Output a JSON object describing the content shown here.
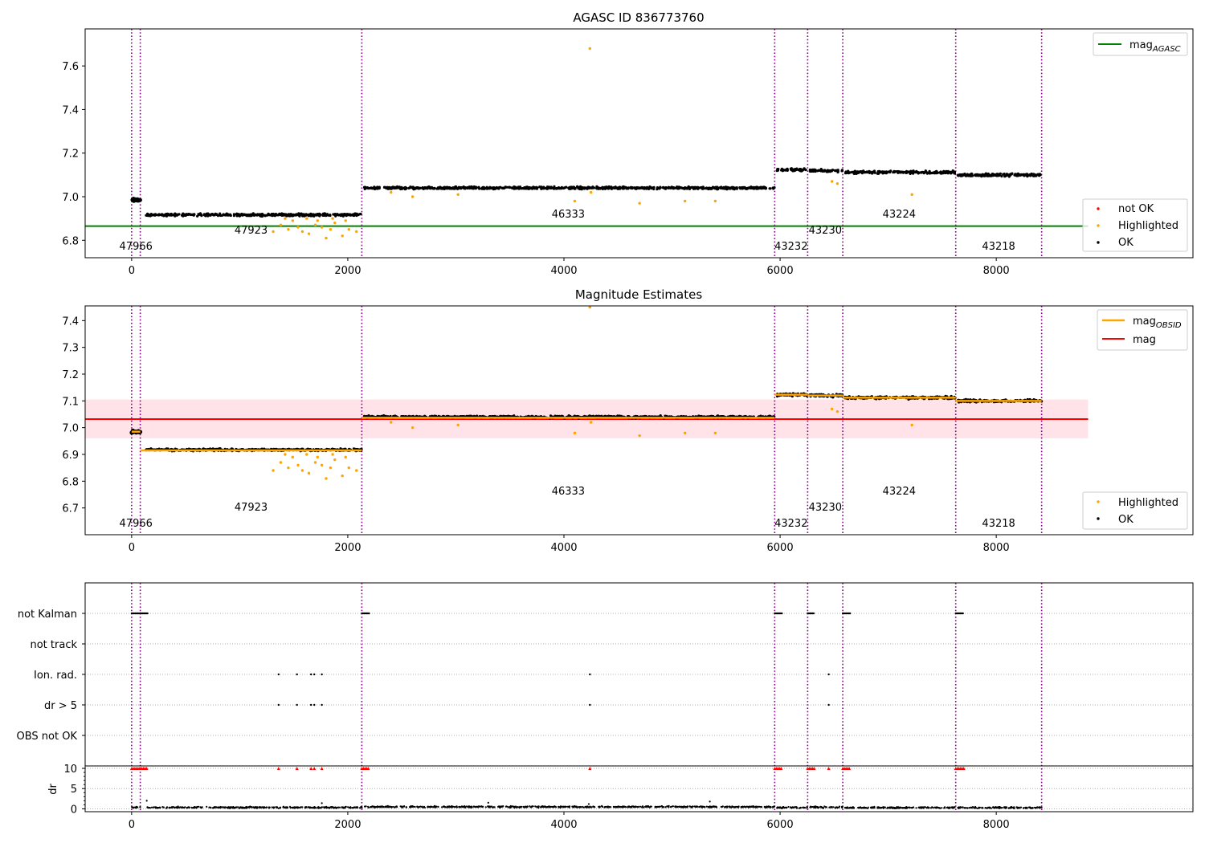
{
  "colors": {
    "ok": "#000000",
    "highlighted": "#ffa500",
    "not_ok": "#ff0000",
    "mag_agasc_line": "#008000",
    "mag_obsid_line": "#ffa500",
    "mag_line": "#ff0000",
    "mag_band": "#ffc0cb",
    "obsid_boundary": "#800080",
    "flag_grid": "#b0b0b0"
  },
  "chart_data": [
    {
      "type": "scatter",
      "title": "AGASC ID 836773760",
      "xlim": [
        -430,
        9820
      ],
      "ylim": [
        6.72,
        7.77
      ],
      "xticks": [
        0,
        2000,
        4000,
        6000,
        8000
      ],
      "xtick_labels": [
        "0",
        "2000",
        "4000",
        "6000",
        "8000"
      ],
      "yticks": [
        6.8,
        7.0,
        7.2,
        7.4,
        7.6
      ],
      "ytick_labels": [
        "6.8",
        "7.0",
        "7.2",
        "7.4",
        "7.6"
      ],
      "grid": false,
      "obsid_boundaries": [
        0,
        80,
        2130,
        5950,
        6255,
        6580,
        7625,
        8420
      ],
      "obsids": [
        {
          "label": "47966",
          "x": 40,
          "y_level": 0
        },
        {
          "label": "47923",
          "x": 1105,
          "y_level": 1
        },
        {
          "label": "46333",
          "x": 4040,
          "y_level": 2
        },
        {
          "label": "43232",
          "x": 6102,
          "y_level": 0
        },
        {
          "label": "43230",
          "x": 6418,
          "y_level": 1
        },
        {
          "label": "43224",
          "x": 7102,
          "y_level": 2
        },
        {
          "label": "43218",
          "x": 8022,
          "y_level": 0
        }
      ],
      "ok_segments": [
        {
          "x": [
            0,
            80
          ],
          "y": 6.985,
          "spread": 0.008
        },
        {
          "x": [
            130,
            2130
          ],
          "y": 6.917,
          "spread": 0.008
        },
        {
          "x": [
            2150,
            5950
          ],
          "y": 7.04,
          "spread": 0.008
        },
        {
          "x": [
            5970,
            6255
          ],
          "y": 7.123,
          "spread": 0.009
        },
        {
          "x": [
            6275,
            6580
          ],
          "y": 7.12,
          "spread": 0.009
        },
        {
          "x": [
            6600,
            7625
          ],
          "y": 7.112,
          "spread": 0.009
        },
        {
          "x": [
            7645,
            8420
          ],
          "y": 7.1,
          "spread": 0.009
        }
      ],
      "highlighted_points": [
        [
          1310,
          6.84
        ],
        [
          1380,
          6.87
        ],
        [
          1450,
          6.85
        ],
        [
          1540,
          6.86
        ],
        [
          1580,
          6.84
        ],
        [
          1640,
          6.83
        ],
        [
          1700,
          6.87
        ],
        [
          1760,
          6.86
        ],
        [
          1800,
          6.81
        ],
        [
          1840,
          6.85
        ],
        [
          1880,
          6.88
        ],
        [
          1950,
          6.82
        ],
        [
          2010,
          6.85
        ],
        [
          2080,
          6.84
        ],
        [
          1420,
          6.9
        ],
        [
          1490,
          6.89
        ],
        [
          1620,
          6.9
        ],
        [
          1720,
          6.89
        ],
        [
          1860,
          6.9
        ],
        [
          1980,
          6.89
        ],
        [
          2400,
          7.02
        ],
        [
          2600,
          7.0
        ],
        [
          3020,
          7.01
        ],
        [
          4100,
          6.98
        ],
        [
          4250,
          7.02
        ],
        [
          4700,
          6.97
        ],
        [
          5120,
          6.98
        ],
        [
          5400,
          6.98
        ],
        [
          6480,
          7.07
        ],
        [
          6530,
          7.06
        ],
        [
          7220,
          7.01
        ],
        [
          4240,
          7.68
        ]
      ],
      "mag_agasc": 6.865,
      "legends": [
        {
          "position": "upper right",
          "entries": [
            {
              "label": "mag",
              "subscript": "AGASC",
              "kind": "line",
              "color_key": "mag_agasc_line"
            }
          ]
        },
        {
          "position": "lower right",
          "entries": [
            {
              "label": "not OK",
              "kind": "marker",
              "color_key": "not_ok"
            },
            {
              "label": "Highlighted",
              "kind": "marker",
              "color_key": "highlighted"
            },
            {
              "label": "OK",
              "kind": "marker",
              "color_key": "ok"
            }
          ]
        }
      ]
    },
    {
      "type": "scatter",
      "title": "Magnitude Estimates",
      "xlim": [
        -430,
        9820
      ],
      "ylim": [
        6.6,
        7.455
      ],
      "xticks": [
        0,
        2000,
        4000,
        6000,
        8000
      ],
      "xtick_labels": [
        "0",
        "2000",
        "4000",
        "6000",
        "8000"
      ],
      "yticks": [
        6.7,
        6.8,
        6.9,
        7.0,
        7.1,
        7.2,
        7.3,
        7.4
      ],
      "ytick_labels": [
        "6.7",
        "6.8",
        "6.9",
        "7.0",
        "7.1",
        "7.2",
        "7.3",
        "7.4"
      ],
      "grid": false,
      "obsid_boundaries": [
        0,
        80,
        2130,
        5950,
        6255,
        6580,
        7625,
        8420
      ],
      "obsids": [
        {
          "label": "47966",
          "x": 40,
          "y_level": 0
        },
        {
          "label": "47923",
          "x": 1105,
          "y_level": 1
        },
        {
          "label": "46333",
          "x": 4040,
          "y_level": 2
        },
        {
          "label": "43232",
          "x": 6102,
          "y_level": 0
        },
        {
          "label": "43230",
          "x": 6418,
          "y_level": 1
        },
        {
          "label": "43224",
          "x": 7102,
          "y_level": 2
        },
        {
          "label": "43218",
          "x": 8022,
          "y_level": 0
        }
      ],
      "ok_segments": [
        {
          "x": [
            0,
            80
          ],
          "y": 6.985,
          "spread": 0.006
        },
        {
          "x": [
            130,
            2130
          ],
          "y": 6.917,
          "spread": 0.006
        },
        {
          "x": [
            2150,
            5950
          ],
          "y": 7.04,
          "spread": 0.006
        },
        {
          "x": [
            5970,
            6255
          ],
          "y": 7.123,
          "spread": 0.007
        },
        {
          "x": [
            6275,
            6580
          ],
          "y": 7.12,
          "spread": 0.007
        },
        {
          "x": [
            6600,
            7625
          ],
          "y": 7.112,
          "spread": 0.007
        },
        {
          "x": [
            7645,
            8420
          ],
          "y": 7.1,
          "spread": 0.007
        }
      ],
      "highlighted_points": [
        [
          1310,
          6.84
        ],
        [
          1380,
          6.87
        ],
        [
          1450,
          6.85
        ],
        [
          1540,
          6.86
        ],
        [
          1580,
          6.84
        ],
        [
          1640,
          6.83
        ],
        [
          1700,
          6.87
        ],
        [
          1760,
          6.86
        ],
        [
          1800,
          6.81
        ],
        [
          1840,
          6.85
        ],
        [
          1880,
          6.88
        ],
        [
          1950,
          6.82
        ],
        [
          2010,
          6.85
        ],
        [
          2080,
          6.84
        ],
        [
          1420,
          6.9
        ],
        [
          1490,
          6.89
        ],
        [
          1620,
          6.9
        ],
        [
          1720,
          6.89
        ],
        [
          1860,
          6.9
        ],
        [
          1980,
          6.89
        ],
        [
          2400,
          7.02
        ],
        [
          2600,
          7.0
        ],
        [
          3020,
          7.01
        ],
        [
          4100,
          6.98
        ],
        [
          4250,
          7.02
        ],
        [
          4700,
          6.97
        ],
        [
          5120,
          6.98
        ],
        [
          5400,
          6.98
        ],
        [
          6480,
          7.07
        ],
        [
          6530,
          7.06
        ],
        [
          7220,
          7.01
        ],
        [
          4240,
          7.45
        ]
      ],
      "mag_obsid": [
        {
          "x": [
            0,
            80
          ],
          "y": 6.985
        },
        {
          "x": [
            80,
            2130
          ],
          "y": 6.915
        },
        {
          "x": [
            2130,
            5950
          ],
          "y": 7.037
        },
        {
          "x": [
            5950,
            6255
          ],
          "y": 7.123
        },
        {
          "x": [
            6255,
            6580
          ],
          "y": 7.12
        },
        {
          "x": [
            6580,
            7625
          ],
          "y": 7.112
        },
        {
          "x": [
            7625,
            8420
          ],
          "y": 7.1
        }
      ],
      "mag": 7.032,
      "mag_band": [
        6.96,
        7.105
      ],
      "mag_band_x": [
        -430,
        8850
      ],
      "legends": [
        {
          "position": "upper right",
          "entries": [
            {
              "label": "mag",
              "subscript": "OBSID",
              "kind": "line",
              "color_key": "mag_obsid_line"
            },
            {
              "label": "mag",
              "subscript": "",
              "kind": "line",
              "color_key": "mag_line"
            }
          ]
        },
        {
          "position": "lower right",
          "entries": [
            {
              "label": "Highlighted",
              "kind": "marker",
              "color_key": "highlighted"
            },
            {
              "label": "OK",
              "kind": "marker",
              "color_key": "ok"
            }
          ]
        }
      ]
    },
    {
      "type": "scatter",
      "title": "",
      "xlim": [
        -430,
        9820
      ],
      "xticks": [
        0,
        2000,
        4000,
        6000,
        8000
      ],
      "xtick_labels": [
        "0",
        "2000",
        "4000",
        "6000",
        "8000"
      ],
      "obsid_boundaries": [
        0,
        80,
        2130,
        5950,
        6255,
        6580,
        7625,
        8420
      ],
      "flag_rows": [
        "not Kalman",
        "not track",
        "Ion. rad.",
        "dr > 5",
        "OBS not OK"
      ],
      "flag_points": {
        "not Kalman": [
          [
            0,
            80
          ],
          [
            80,
            150
          ],
          [
            2130,
            2200
          ],
          [
            5950,
            6020
          ],
          [
            6255,
            6320
          ],
          [
            6580,
            6650
          ],
          [
            7625,
            7700
          ]
        ],
        "not track": [],
        "Ion. rad.": [
          1360,
          1530,
          1660,
          1690,
          1760,
          4240,
          6450
        ],
        "dr > 5": [
          1360,
          1530,
          1660,
          1690,
          1760,
          4240,
          6450
        ],
        "OBS not OK": []
      },
      "dr": {
        "ylabel": "dr",
        "yticks": [
          0,
          5,
          10
        ],
        "ytick_labels": [
          "0",
          "5",
          "10"
        ],
        "ylim": [
          -0.7,
          10.6
        ],
        "clipped_markers": [
          [
            0,
            80
          ],
          [
            80,
            150
          ],
          [
            2130,
            2200
          ],
          [
            5950,
            6020
          ],
          [
            6255,
            6320
          ],
          [
            6580,
            6650
          ],
          [
            7625,
            7700
          ]
        ],
        "clipped_singles": [
          1360,
          1530,
          1660,
          1690,
          1760,
          4240,
          6450
        ],
        "clipped_value": 10,
        "segments": [
          {
            "x": [
              0,
              80
            ],
            "y": 0.4
          },
          {
            "x": [
              130,
              2130
            ],
            "y": 0.35
          },
          {
            "x": [
              2150,
              5950
            ],
            "y": 0.5
          },
          {
            "x": [
              5970,
              6255
            ],
            "y": 0.3
          },
          {
            "x": [
              6275,
              6580
            ],
            "y": 0.4
          },
          {
            "x": [
              6600,
              7625
            ],
            "y": 0.3
          },
          {
            "x": [
              7645,
              8420
            ],
            "y": 0.3
          }
        ],
        "outliers": [
          [
            140,
            2.0
          ],
          [
            3300,
            1.5
          ],
          [
            5350,
            1.8
          ],
          [
            4230,
            1.2
          ],
          [
            1760,
            1.4
          ]
        ]
      }
    }
  ]
}
